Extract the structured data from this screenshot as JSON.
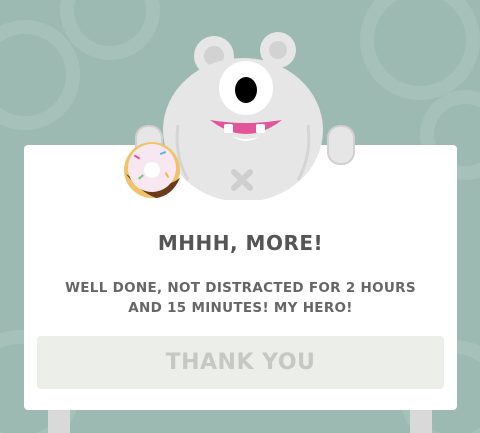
{
  "dialog": {
    "title": "MHHH, MORE!",
    "message": "WELL DONE, NOT DISTRACTED FOR 2 HOURS AND 15 MINUTES! MY HERO!",
    "button_label": "THANK YOU"
  },
  "colors": {
    "background": "#9cbab1",
    "dialog": "#ffffff",
    "title_text": "#555555",
    "button_bg": "#eceee9",
    "button_text": "#c6c8c3",
    "mouth": "#e2559a"
  },
  "icons": {
    "mascot": "one-eyed-bear-mascot",
    "donut": "donut-icon"
  }
}
